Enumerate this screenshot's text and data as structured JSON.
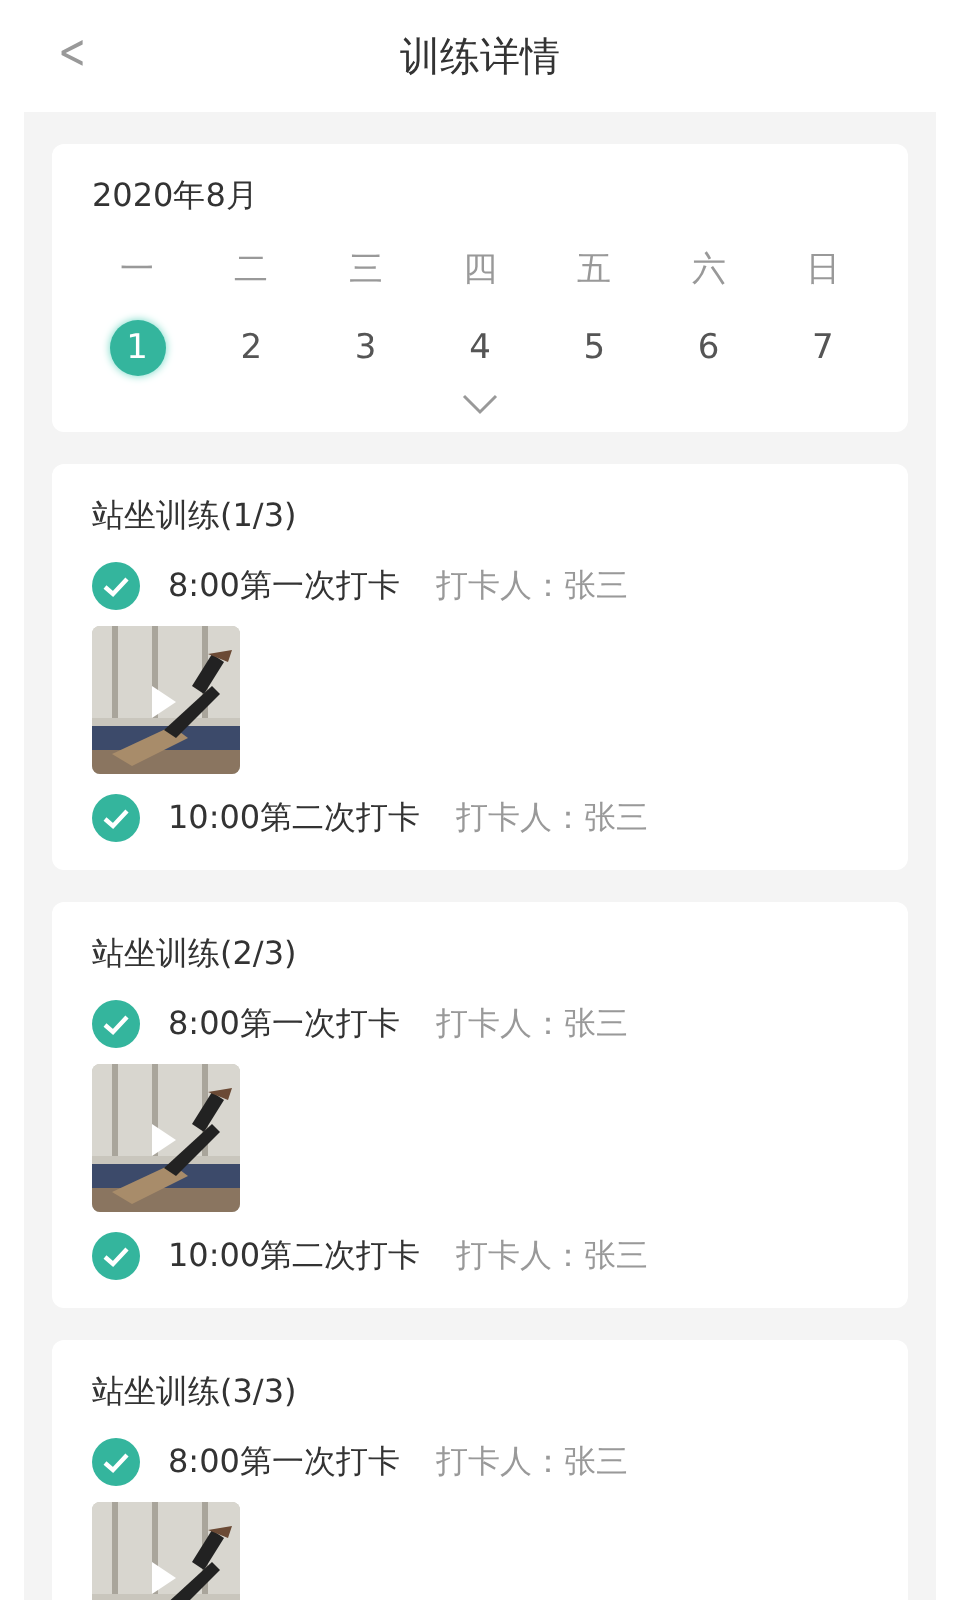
{
  "header": {
    "back": "<",
    "title": "训练详情"
  },
  "calendar": {
    "month": "2020年8月",
    "weekdays": [
      "一",
      "二",
      "三",
      "四",
      "五",
      "六",
      "日"
    ],
    "days": [
      {
        "label": "1",
        "selected": true
      },
      {
        "label": "2",
        "selected": false
      },
      {
        "label": "3",
        "selected": false
      },
      {
        "label": "4",
        "selected": false
      },
      {
        "label": "5",
        "selected": false
      },
      {
        "label": "6",
        "selected": false
      },
      {
        "label": "7",
        "selected": false
      }
    ],
    "expanded": false
  },
  "sessions": [
    {
      "title": "站坐训练(1/3)",
      "entries": [
        {
          "kind": "checkin",
          "checked": true,
          "time": "8:00第一次打卡",
          "checker": "打卡人：张三"
        },
        {
          "kind": "video"
        },
        {
          "kind": "checkin",
          "checked": true,
          "time": "10:00第二次打卡",
          "checker": "打卡人：张三"
        }
      ]
    },
    {
      "title": "站坐训练(2/3)",
      "entries": [
        {
          "kind": "checkin",
          "checked": true,
          "time": "8:00第一次打卡",
          "checker": "打卡人：张三"
        },
        {
          "kind": "video"
        },
        {
          "kind": "checkin",
          "checked": true,
          "time": "10:00第二次打卡",
          "checker": "打卡人：张三"
        }
      ]
    },
    {
      "title": "站坐训练(3/3)",
      "entries": [
        {
          "kind": "checkin",
          "checked": true,
          "time": "8:00第一次打卡",
          "checker": "打卡人：张三"
        },
        {
          "kind": "video"
        }
      ]
    }
  ]
}
